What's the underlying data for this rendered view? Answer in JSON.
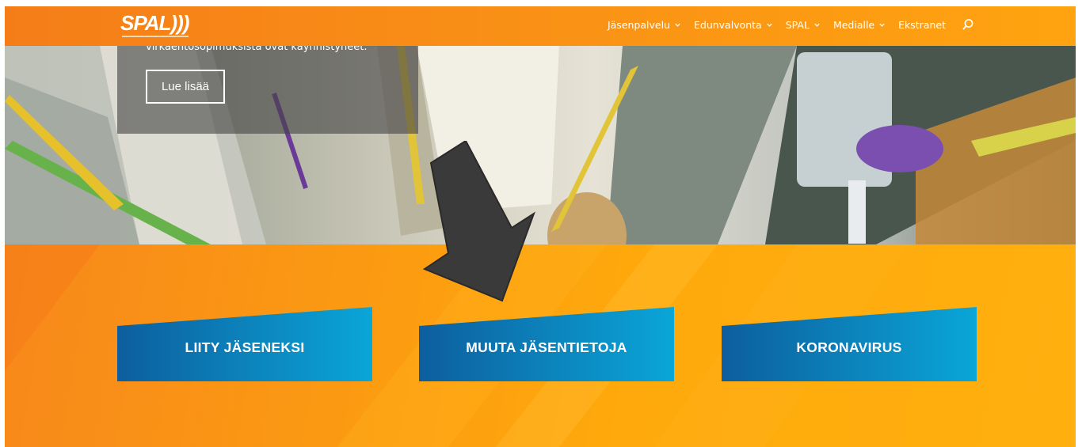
{
  "header": {
    "logo_text": "SPAL)))",
    "nav": [
      {
        "label": "Jäsenpalvelu",
        "has_dropdown": true
      },
      {
        "label": "Edunvalvonta",
        "has_dropdown": true
      },
      {
        "label": "SPAL",
        "has_dropdown": true
      },
      {
        "label": "Medialle",
        "has_dropdown": true
      },
      {
        "label": "Ekstranet",
        "has_dropdown": false
      }
    ],
    "search_icon": "search-icon"
  },
  "hero": {
    "card_text": "virkaehtosopimuksista ovat käynnistyneet.",
    "button_label": "Lue lisää"
  },
  "actions": [
    {
      "label": "LIITY JÄSENEKSI"
    },
    {
      "label": "MUUTA JÄSENTIETOJA"
    },
    {
      "label": "KORONAVIRUS"
    }
  ],
  "colors": {
    "brand_orange": "#f7861c",
    "button_blue_dark": "#0d5e9e",
    "button_blue_light": "#0aa6d8",
    "arrow": "#3a3a3a"
  }
}
